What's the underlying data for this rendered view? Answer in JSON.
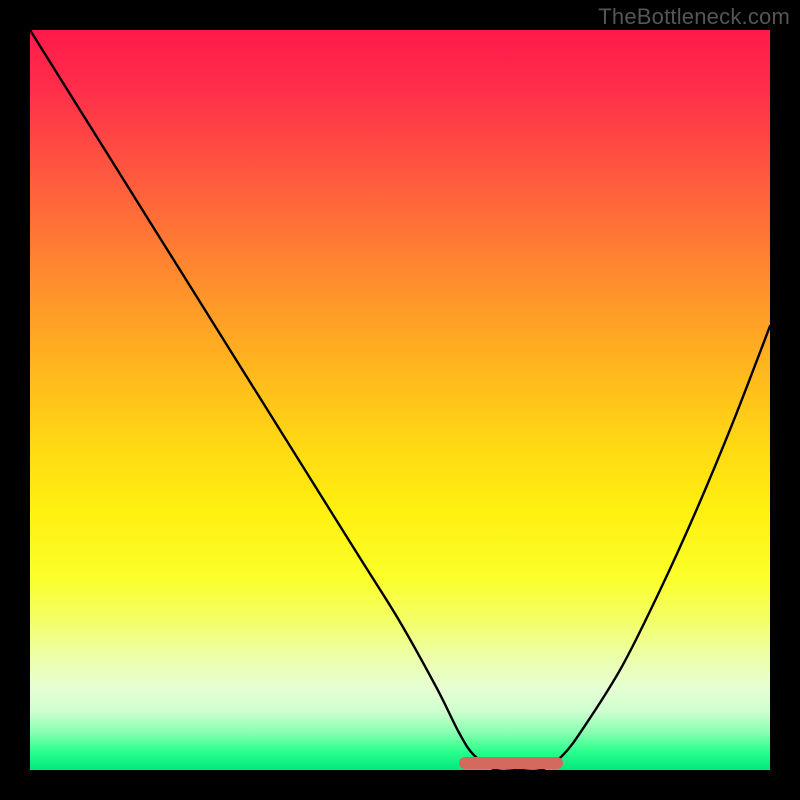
{
  "watermark": "TheBottleneck.com",
  "colors": {
    "frame": "#000000",
    "curve": "#000000",
    "marker": "#d46a5e"
  },
  "chart_data": {
    "type": "line",
    "title": "",
    "xlabel": "",
    "ylabel": "",
    "xlim": [
      0,
      100
    ],
    "ylim": [
      0,
      100
    ],
    "grid": false,
    "legend": false,
    "description": "Bottleneck curve over red-to-green vertical gradient; minimum band highlighted near x≈60–70.",
    "series": [
      {
        "name": "bottleneck-curve",
        "x": [
          0,
          5,
          10,
          15,
          20,
          25,
          30,
          35,
          40,
          45,
          50,
          55,
          58,
          60,
          63,
          66,
          69,
          72,
          75,
          80,
          85,
          90,
          95,
          100
        ],
        "y": [
          100,
          92,
          84,
          76,
          68,
          60,
          52,
          44,
          36,
          28,
          20,
          11,
          5,
          2,
          0,
          0,
          0,
          2,
          6,
          14,
          24,
          35,
          47,
          60
        ]
      }
    ],
    "minimum_band": {
      "x_start": 58,
      "x_end": 72,
      "y": 0
    }
  }
}
